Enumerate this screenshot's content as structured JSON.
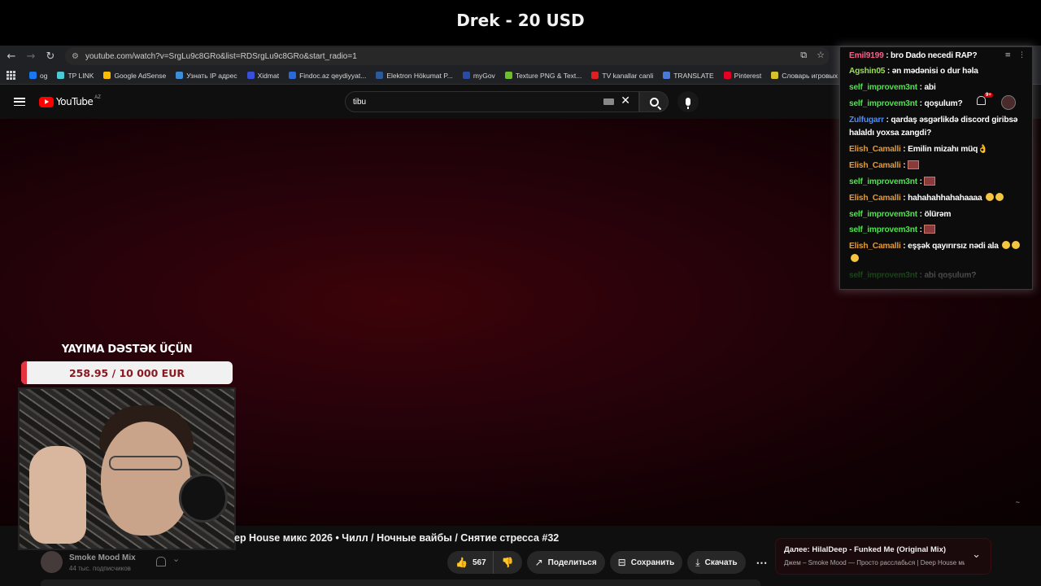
{
  "stream_title": "Drek - 20 USD",
  "browser": {
    "url": "youtube.com/watch?v=SrgLu9c8GRo&list=RDSrgLu9c8GRo&start_radio=1",
    "bookmarks": [
      {
        "label": "og",
        "color": "#1877f2"
      },
      {
        "label": "TP LINK",
        "color": "#4acbd6"
      },
      {
        "label": "Google AdSense",
        "color": "#fbbc04"
      },
      {
        "label": "Узнать IP адрес",
        "color": "#3a8fd8"
      },
      {
        "label": "Xidmat",
        "color": "#3a4fd8"
      },
      {
        "label": "Findoc.az qeydiyyat...",
        "color": "#2a6ad8"
      },
      {
        "label": "Elektron Hökumat P...",
        "color": "#2a5a9a"
      },
      {
        "label": "myGov",
        "color": "#2a4aa8"
      },
      {
        "label": "Texture PNG & Text...",
        "color": "#6abf2a"
      },
      {
        "label": "TV kanallar canli",
        "color": "#e02020"
      },
      {
        "label": "TRANSLATE",
        "color": "#4a7ad8"
      },
      {
        "label": "Pinterest",
        "color": "#e60023"
      },
      {
        "label": "Словарь игровых т...",
        "color": "#d8c02a"
      }
    ]
  },
  "youtube": {
    "logo_text": "YouTube",
    "country_code": "AZ",
    "search_query": "tibu",
    "video_title": "ep House микс 2026 • Чилл / Ночные вайбы / Снятие стресса #32",
    "channel_name": "Smoke Mood Mix",
    "channel_subs": "44 тыс. подписчиков",
    "like_count": "567",
    "share_label": "Поделиться",
    "save_label": "Сохранить",
    "download_label": "Скачать",
    "up_next_title": "Далее: HilalDeep - Funked Me (Original Mix)",
    "up_next_subtitle": "Джем – Smoke Mood — Просто расслабься | Deep House ми",
    "player_corner_text": "~"
  },
  "donation": {
    "label": "YAYIMA DƏSTƏK ÜÇÜN",
    "progress_text": "258.95 / 10 000 EUR",
    "progress_fraction": 0.0259
  },
  "chat": {
    "notification_count": "9+",
    "messages": [
      {
        "nick": "Emil9199",
        "text": ": bro Dado necedi RAP?",
        "color": "pink"
      },
      {
        "nick": "Agshin05",
        "text": ": ən mədənisi o dur həla",
        "color": "lime"
      },
      {
        "nick": "self_improvem3nt",
        "text": ": abi",
        "color": "green"
      },
      {
        "nick": "self_improvem3nt",
        "text": ": qoşulum?",
        "color": "green"
      },
      {
        "nick": "Zulfugarr",
        "text": ": qardaş əsgərlikdə discord giribsə halaldı yoxsa zangdi?",
        "color": "blue"
      },
      {
        "nick": "Elish_Camalli",
        "text": ": Emilin mizahı müq👌",
        "color": "orange"
      },
      {
        "nick": "Elish_Camalli",
        "text": ":",
        "color": "orange",
        "pic": true
      },
      {
        "nick": "self_improvem3nt",
        "text": ":",
        "color": "green",
        "pic": true
      },
      {
        "nick": "Elish_Camalli",
        "text": ": hahahahhahahaaaa",
        "color": "orange",
        "emoji": 2
      },
      {
        "nick": "self_improvem3nt",
        "text": ": ölürəm",
        "color": "green"
      },
      {
        "nick": "self_improvem3nt",
        "text": ":",
        "color": "green",
        "pic": true
      },
      {
        "nick": "Elish_Camalli",
        "text": ": eşşək qayırırsız nədi ala",
        "color": "orange",
        "emoji": 3
      },
      {
        "nick": "self_improvem3nt",
        "text": ": abi qoşulum?",
        "color": "green"
      }
    ]
  }
}
